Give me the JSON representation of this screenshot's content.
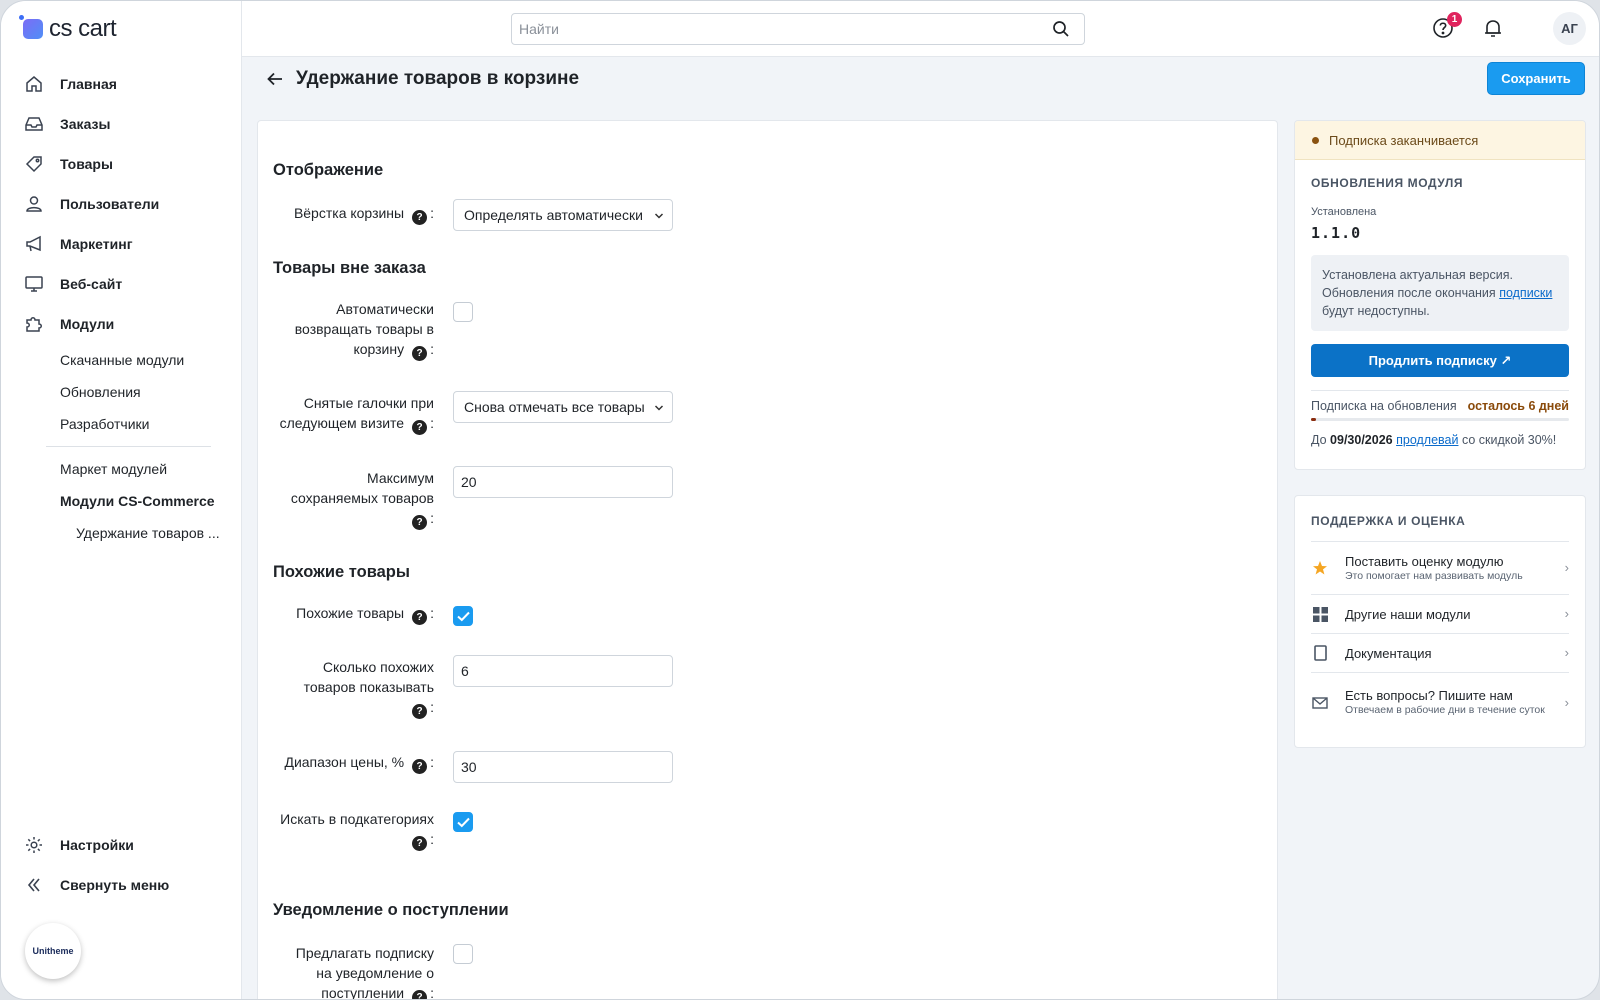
{
  "app": {
    "logo_text": "cs cart",
    "search_placeholder": "Найти",
    "help_badge": "1",
    "user_initials": "АГ",
    "unitheme_label": "Unitheme"
  },
  "sidebar": {
    "items": [
      {
        "label": "Главная",
        "icon": "home-icon"
      },
      {
        "label": "Заказы",
        "icon": "inbox-icon"
      },
      {
        "label": "Товары",
        "icon": "tag-icon"
      },
      {
        "label": "Пользователи",
        "icon": "user-icon"
      },
      {
        "label": "Маркетинг",
        "icon": "megaphone-icon"
      },
      {
        "label": "Веб-сайт",
        "icon": "monitor-icon"
      },
      {
        "label": "Модули",
        "icon": "puzzle-icon"
      }
    ],
    "subitems": [
      "Скачанные модули",
      "Обновления",
      "Разработчики"
    ],
    "subitems2": [
      "Маркет модулей",
      "Модули CS-Commerce"
    ],
    "current": "Удержание товаров ...",
    "bottom": [
      {
        "label": "Настройки",
        "icon": "gear-icon"
      },
      {
        "label": "Свернуть меню",
        "icon": "collapse-icon"
      }
    ]
  },
  "header": {
    "title": "Удержание товаров в корзине",
    "save_label": "Сохранить"
  },
  "form": {
    "sections": {
      "display": "Отображение",
      "outside": "Товары вне заказа",
      "similar": "Похожие товары",
      "notify": "Уведомление о поступлении"
    },
    "fields": {
      "cart_layout": {
        "label": "Вёрстка корзины",
        "value": "Определять автоматически"
      },
      "auto_return": {
        "label_lines": [
          "Автоматически",
          "возвращать товары в",
          "корзину"
        ],
        "checked": false
      },
      "unchecked_next": {
        "label_lines": [
          "Снятые галочки при",
          "следующем визите"
        ],
        "value": "Снова отмечать все товары"
      },
      "max_saved": {
        "label_lines": [
          "Максимум",
          "сохраняемых товаров"
        ],
        "value": "20"
      },
      "similar_enabled": {
        "label": "Похожие товары",
        "checked": true
      },
      "similar_count": {
        "label_lines": [
          "Сколько похожих",
          "товаров показывать"
        ],
        "value": "6"
      },
      "price_range": {
        "label": "Диапазон цены, %",
        "value": "30"
      },
      "search_subcats": {
        "label": "Искать в подкатегориях",
        "checked": true
      },
      "offer_notify": {
        "label_lines": [
          "Предлагать подписку",
          "на уведомление о",
          "поступлении"
        ],
        "checked": false
      }
    }
  },
  "updates_card": {
    "warning": "Подписка заканчивается",
    "title": "ОБНОВЛЕНИЯ МОДУЛЯ",
    "installed_label": "Установлена",
    "version": "1.1.0",
    "info_text": "Установлена актуальная версия. Обновления после окончания",
    "info_link": "подписки",
    "info_tail": "будут недоступны.",
    "renew_label": "Продлить подписку ↗",
    "sub_label": "Подписка на обновления",
    "sub_remaining": "осталось 6 дней",
    "sub_progress": 0.02,
    "promo_prefix": "До",
    "promo_date": "09/30/2026",
    "promo_link": "продлевай",
    "promo_tail": "со скидкой 30%!"
  },
  "support_card": {
    "title": "ПОДДЕРЖКА И ОЦЕНКА",
    "items": [
      {
        "title": "Поставить оценку модулю",
        "sub": "Это помогает нам развивать модуль",
        "icon": "star-icon"
      },
      {
        "title": "Другие наши модули",
        "sub": "",
        "icon": "grid-icon"
      },
      {
        "title": "Документация",
        "sub": "",
        "icon": "document-icon"
      },
      {
        "title": "Есть вопросы? Пишите нам",
        "sub": "Отвечаем в рабочие дни в течение суток",
        "icon": "mail-icon"
      }
    ]
  },
  "colors": {
    "accent": "#1a9bf0",
    "renew": "#0b72c7",
    "warn_bg": "#fdf5e2",
    "remaining": "#8a2d0f"
  }
}
